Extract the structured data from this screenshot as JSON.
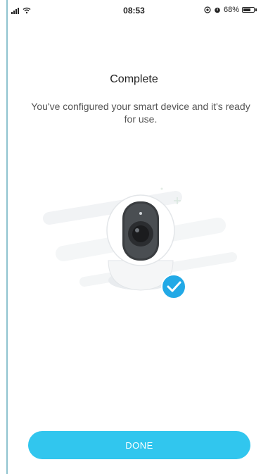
{
  "status_bar": {
    "time": "08:53",
    "battery_text": "68%",
    "battery_level_percent": 68,
    "icons": [
      "signal-icon",
      "wifi-icon",
      "location-icon",
      "alarm-icon",
      "battery-icon"
    ]
  },
  "page": {
    "title": "Complete",
    "message": "You've configured your smart device and it's ready for use.",
    "illustration": "camera-icon",
    "badge_icon": "checkmark-icon"
  },
  "actions": {
    "done_label": "DONE"
  },
  "colors": {
    "accent": "#31c6ee",
    "badge": "#22a9e6",
    "text_primary": "#222222",
    "text_secondary": "#555555"
  }
}
